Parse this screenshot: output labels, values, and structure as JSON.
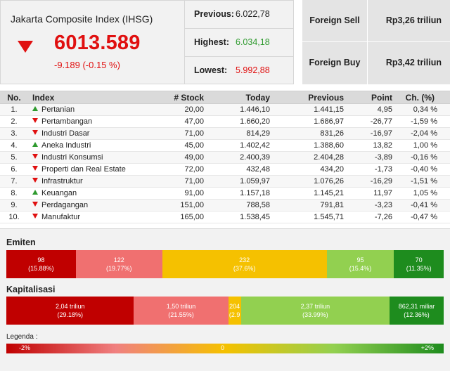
{
  "index": {
    "title": "Jakarta Composite Index (IHSG)",
    "value": "6013.589",
    "change": "-9.189 (-0.15 %)",
    "direction": "down",
    "down_color": "#e01010",
    "up_color": "#2e9a2e"
  },
  "highlights": {
    "previous_label": "Previous:",
    "previous_value": "6.022,78",
    "highest_label": "Highest:",
    "highest_value": "6.034,18",
    "lowest_label": "Lowest:",
    "lowest_value": "5.992,88"
  },
  "foreign": {
    "sell_label": "Foreign Sell",
    "sell_value": "Rp3,26 triliun",
    "buy_label": "Foreign Buy",
    "buy_value": "Rp3,42 triliun"
  },
  "table": {
    "headers": [
      "No.",
      "Index",
      "# Stock",
      "Today",
      "Previous",
      "Point",
      "Ch. (%)"
    ],
    "rows": [
      {
        "no": "1.",
        "name": "Pertanian",
        "dir": "up",
        "stock": "20,00",
        "today": "1.446,10",
        "previous": "1.441,15",
        "point": "4,95",
        "change": "0,34 %"
      },
      {
        "no": "2.",
        "name": "Pertambangan",
        "dir": "down",
        "stock": "47,00",
        "today": "1.660,20",
        "previous": "1.686,97",
        "point": "-26,77",
        "change": "-1,59 %"
      },
      {
        "no": "3.",
        "name": "Industri Dasar",
        "dir": "down",
        "stock": "71,00",
        "today": "814,29",
        "previous": "831,26",
        "point": "-16,97",
        "change": "-2,04 %"
      },
      {
        "no": "4.",
        "name": "Aneka Industri",
        "dir": "up",
        "stock": "45,00",
        "today": "1.402,42",
        "previous": "1.388,60",
        "point": "13,82",
        "change": "1,00 %"
      },
      {
        "no": "5.",
        "name": "Industri Konsumsi",
        "dir": "down",
        "stock": "49,00",
        "today": "2.400,39",
        "previous": "2.404,28",
        "point": "-3,89",
        "change": "-0,16 %"
      },
      {
        "no": "6.",
        "name": "Properti dan Real Estate",
        "dir": "down",
        "stock": "72,00",
        "today": "432,48",
        "previous": "434,20",
        "point": "-1,73",
        "change": "-0,40 %"
      },
      {
        "no": "7.",
        "name": "Infrastruktur",
        "dir": "down",
        "stock": "71,00",
        "today": "1.059,97",
        "previous": "1.076,26",
        "point": "-16,29",
        "change": "-1,51 %"
      },
      {
        "no": "8.",
        "name": "Keuangan",
        "dir": "up",
        "stock": "91,00",
        "today": "1.157,18",
        "previous": "1.145,21",
        "point": "11,97",
        "change": "1,05 %"
      },
      {
        "no": "9.",
        "name": "Perdagangan",
        "dir": "down",
        "stock": "151,00",
        "today": "788,58",
        "previous": "791,81",
        "point": "-3,23",
        "change": "-0,41 %"
      },
      {
        "no": "10.",
        "name": "Manufaktur",
        "dir": "down",
        "stock": "165,00",
        "today": "1.538,45",
        "previous": "1.545,71",
        "point": "-7,26",
        "change": "-0,47 %"
      }
    ]
  },
  "emiten": {
    "title": "Emiten",
    "segments": [
      {
        "value": "98",
        "pct": "(15.88%)",
        "share": 15.88,
        "color": "#c00000"
      },
      {
        "value": "122",
        "pct": "(19.77%)",
        "share": 19.77,
        "color": "#f07070"
      },
      {
        "value": "232",
        "pct": "(37.6%)",
        "share": 37.6,
        "color": "#f5c100"
      },
      {
        "value": "95",
        "pct": "(15.4%)",
        "share": 15.4,
        "color": "#92d050"
      },
      {
        "value": "70",
        "pct": "(11.35%)",
        "share": 11.35,
        "color": "#1e8c1e"
      }
    ]
  },
  "kapitalisasi": {
    "title": "Kapitalisasi",
    "segments": [
      {
        "value": "2,04 triliun",
        "pct": "(29.18%)",
        "share": 29.18,
        "color": "#c00000"
      },
      {
        "value": "1,50 triliun",
        "pct": "(21.55%)",
        "share": 21.55,
        "color": "#f07070"
      },
      {
        "value": "204",
        "pct": "(2.9",
        "share": 2.92,
        "color": "#f5c100"
      },
      {
        "value": "2,37 triliun",
        "pct": "(33.99%)",
        "share": 33.99,
        "color": "#92d050"
      },
      {
        "value": "862,31 miliar",
        "pct": "(12.36%)",
        "share": 12.36,
        "color": "#1e8c1e"
      }
    ]
  },
  "legend": {
    "title": "Legenda :",
    "min": "-2%",
    "mid": "0",
    "max": "+2%"
  }
}
